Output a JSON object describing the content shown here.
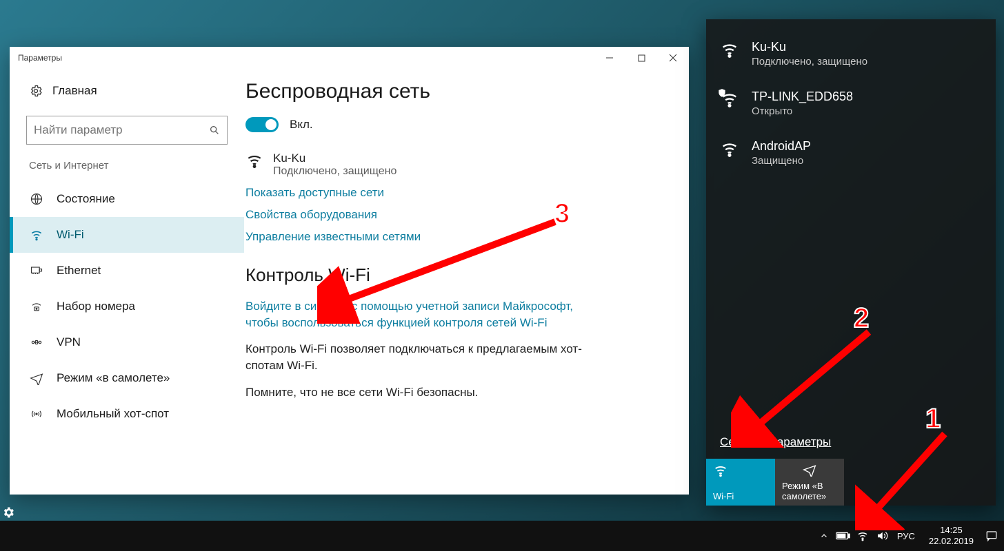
{
  "settings": {
    "title": "Параметры",
    "home": "Главная",
    "search_placeholder": "Найти параметр",
    "group_label": "Сеть и Интернет",
    "nav": {
      "status": "Состояние",
      "wifi": "Wi-Fi",
      "ethernet": "Ethernet",
      "dialup": "Набор номера",
      "vpn": "VPN",
      "airplane": "Режим «в самолете»",
      "hotspot": "Мобильный хот-спот"
    },
    "main": {
      "h1": "Беспроводная сеть",
      "toggle_label": "Вкл.",
      "current_net": {
        "name": "Ku-Ku",
        "sub": "Подключено, защищено"
      },
      "links": {
        "show_nets": "Показать доступные сети",
        "hw_props": "Свойства оборудования",
        "manage_nets": "Управление известными сетями"
      },
      "h2": "Контроль Wi-Fi",
      "signin_link": "Войдите в систему с помощью учетной записи Майкрософт, чтобы воспользоваться функцией контроля сетей Wi-Fi",
      "para1": "Контроль Wi-Fi позволяет подключаться к предлагаемым хот-спотам Wi-Fi.",
      "para2": "Помните, что не все сети Wi-Fi безопасны."
    }
  },
  "flyout": {
    "nets": [
      {
        "name": "Ku-Ku",
        "sub": "Подключено, защищено",
        "secured": true,
        "open": false
      },
      {
        "name": "TP-LINK_EDD658",
        "sub": "Открыто",
        "secured": false,
        "open": true,
        "shield": true
      },
      {
        "name": "AndroidAP",
        "sub": "Защищено",
        "secured": true,
        "open": false
      }
    ],
    "settings_link": "Сетевые параметры",
    "tile_wifi": "Wi-Fi",
    "tile_airplane": "Режим «В самолете»"
  },
  "taskbar": {
    "lang": "РУС",
    "time": "14:25",
    "date": "22.02.2019"
  },
  "annotations": {
    "n1": "1",
    "n2": "2",
    "n3": "3"
  }
}
